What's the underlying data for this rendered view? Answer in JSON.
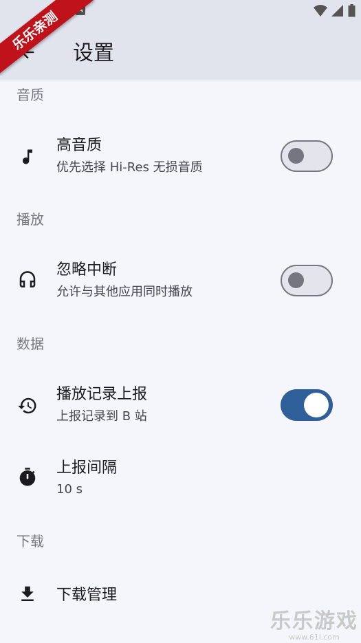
{
  "app_bar": {
    "title": "设置"
  },
  "ribbon": {
    "text": "乐乐亲测"
  },
  "sections": {
    "audio": {
      "header": "音质"
    },
    "playback": {
      "header": "播放"
    },
    "data": {
      "header": "数据"
    },
    "download": {
      "header": "下载"
    }
  },
  "settings": {
    "high_quality": {
      "title": "高音质",
      "subtitle": "优先选择 Hi-Res 无损音质",
      "enabled": false,
      "icon": "music-note-icon"
    },
    "ignore_interrupt": {
      "title": "忽略中断",
      "subtitle": "允许与其他应用同时播放",
      "enabled": false,
      "icon": "headphones-icon"
    },
    "report_history": {
      "title": "播放记录上报",
      "subtitle": "上报记录到 B 站",
      "enabled": true,
      "icon": "history-icon"
    },
    "report_interval": {
      "title": "上报间隔",
      "subtitle": "10 s",
      "icon": "timer-icon"
    },
    "download_manage": {
      "title": "下载管理",
      "icon": "download-icon"
    }
  },
  "watermark": {
    "main": "乐乐游戏",
    "sub": "www.61l.com"
  },
  "colors": {
    "app_bar": "#e1e3ed",
    "background": "#f5f6fb",
    "accent": "#2e5f99",
    "ribbon": "#c0121a"
  }
}
